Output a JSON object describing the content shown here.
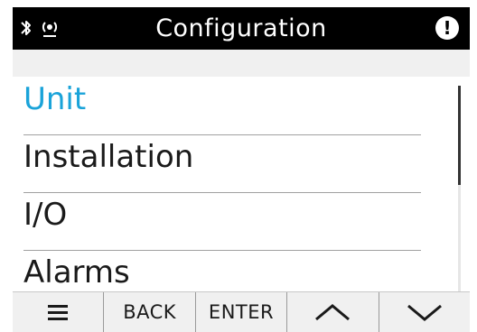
{
  "header": {
    "title": "Configuration",
    "status_alert": "!"
  },
  "menu": {
    "items": [
      {
        "label": "Unit",
        "selected": true
      },
      {
        "label": "Installation"
      },
      {
        "label": "I/O"
      },
      {
        "label": "Alarms"
      }
    ]
  },
  "softkeys": {
    "menu_icon": "hamburger-menu-icon",
    "back_label": "BACK",
    "enter_label": "ENTER",
    "up_icon": "chevron-up-icon",
    "down_icon": "chevron-down-icon"
  },
  "colors": {
    "selected": "#1aa3d9",
    "titlebar": "#000000"
  }
}
